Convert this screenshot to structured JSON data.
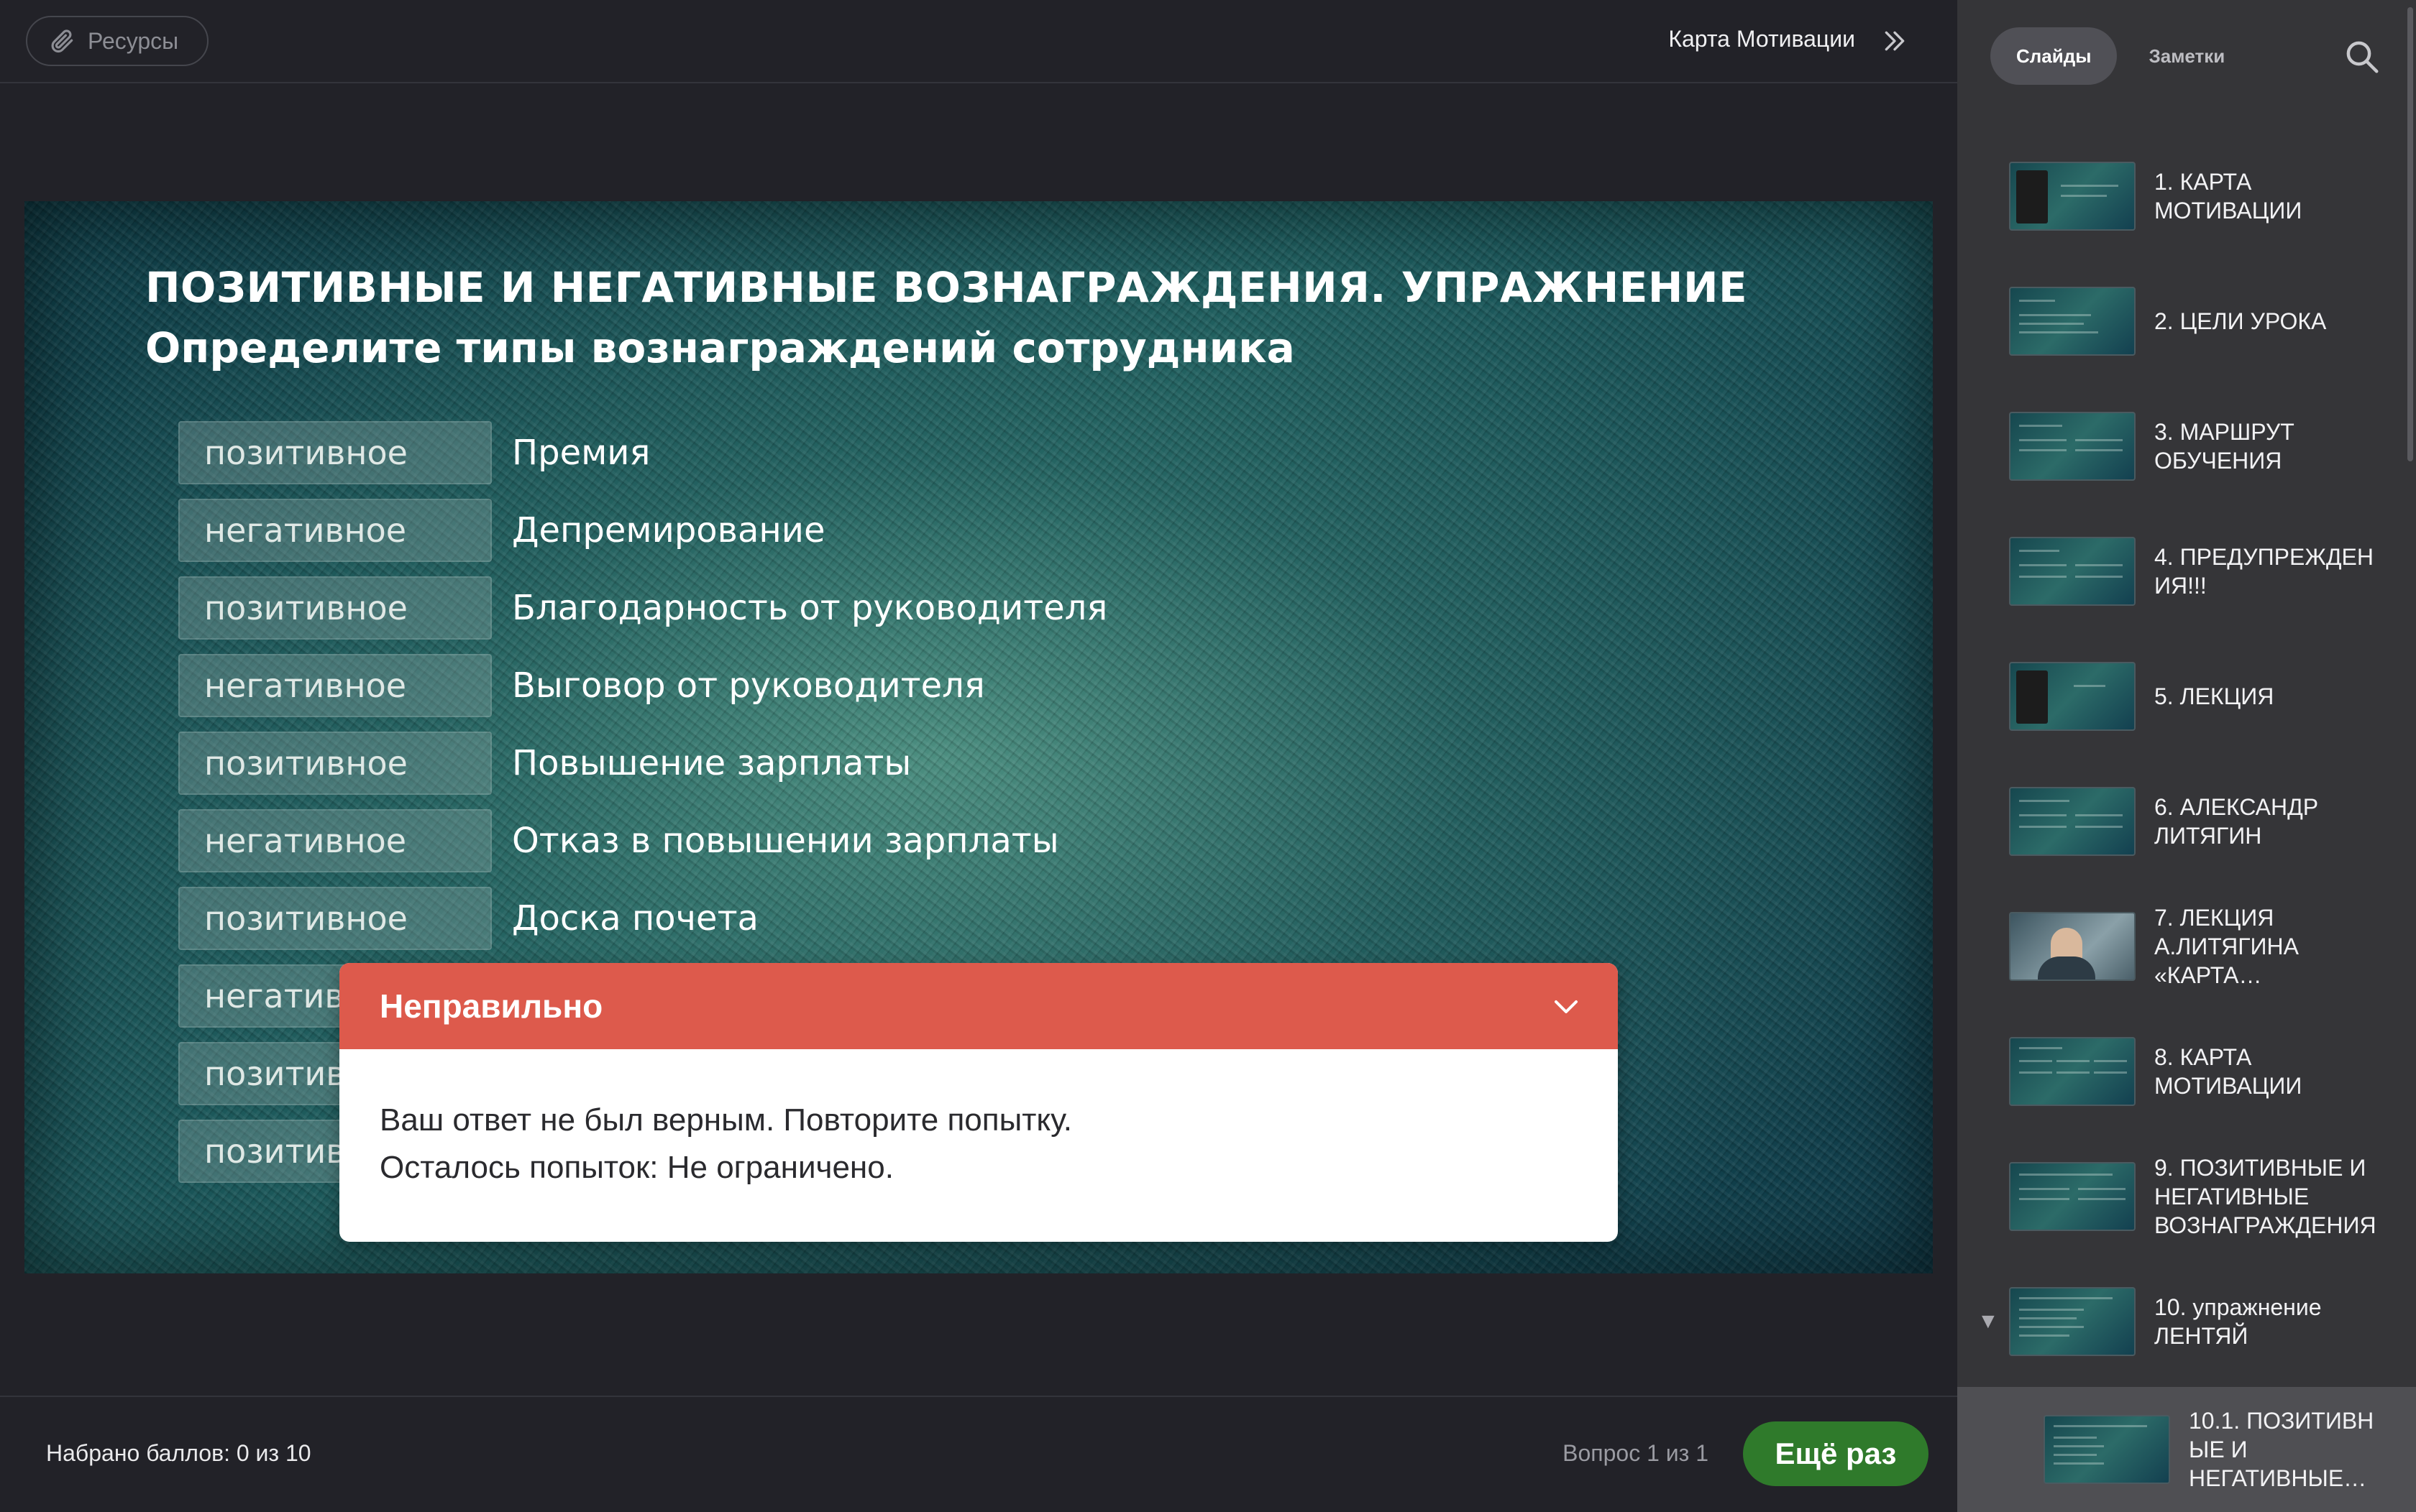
{
  "header": {
    "resources_label": "Ресурсы",
    "course_title": "Карта Мотивации"
  },
  "slide": {
    "title": "ПОЗИТИВНЫЕ И НЕГАТИВНЫЕ ВОЗНАГРАЖДЕНИЯ. УПРАЖНЕНИЕ",
    "subtitle": "Определите типы вознаграждений сотрудника",
    "rows": [
      {
        "chip": "позитивное",
        "text": "Премия"
      },
      {
        "chip": "негативное",
        "text": "Депремирование"
      },
      {
        "chip": "позитивное",
        "text": "Благодарность от руководителя"
      },
      {
        "chip": "негативное",
        "text": "Выговор от руководителя"
      },
      {
        "chip": "позитивное",
        "text": "Повышение зарплаты"
      },
      {
        "chip": "негативное",
        "text": "Отказ в повышении зарплаты"
      },
      {
        "chip": "позитивное",
        "text": "Доска почета"
      },
      {
        "chip": "негативное",
        "text": ""
      },
      {
        "chip": "позитивное",
        "text": ""
      },
      {
        "chip": "позитивное",
        "text": ""
      }
    ]
  },
  "feedback": {
    "title": "Неправильно",
    "line1": "Ваш ответ не был верным. Повторите попытку.",
    "line2": "Осталось попыток: Не ограничено.",
    "header_color": "#dd5a4c"
  },
  "footer": {
    "score": "Набрано баллов: 0 из 10",
    "question_counter": "Вопрос 1 из 1",
    "retry_label": "Ещё раз",
    "retry_color": "#2f7a2b"
  },
  "sidebar": {
    "tabs": [
      {
        "label": "Слайды",
        "active": true
      },
      {
        "label": "Заметки",
        "active": false
      }
    ],
    "slides": [
      {
        "label": "1. КАРТА МОТИВАЦИИ"
      },
      {
        "label": "2. ЦЕЛИ УРОКА"
      },
      {
        "label": "3. МАРШРУТ ОБУЧЕНИЯ"
      },
      {
        "label": "4. ПРЕДУПРЕЖДЕН ИЯ!!!"
      },
      {
        "label": "5. ЛЕКЦИЯ"
      },
      {
        "label": "6. АЛЕКСАНДР ЛИТЯГИН"
      },
      {
        "label": "7. ЛЕКЦИЯ А.ЛИТЯГИНА «КАРТА…"
      },
      {
        "label": "8. КАРТА МОТИВАЦИИ"
      },
      {
        "label": "9. ПОЗИТИВНЫЕ И НЕГАТИВНЫЕ ВОЗНАГРАЖДЕНИЯ"
      },
      {
        "label": "10. упражнение ЛЕНТЯЙ"
      },
      {
        "label": "10.1. ПОЗИТИВН ЫЕ И НЕГАТИВНЫЕ…"
      }
    ],
    "expand_icon": "triangle-down-icon"
  }
}
